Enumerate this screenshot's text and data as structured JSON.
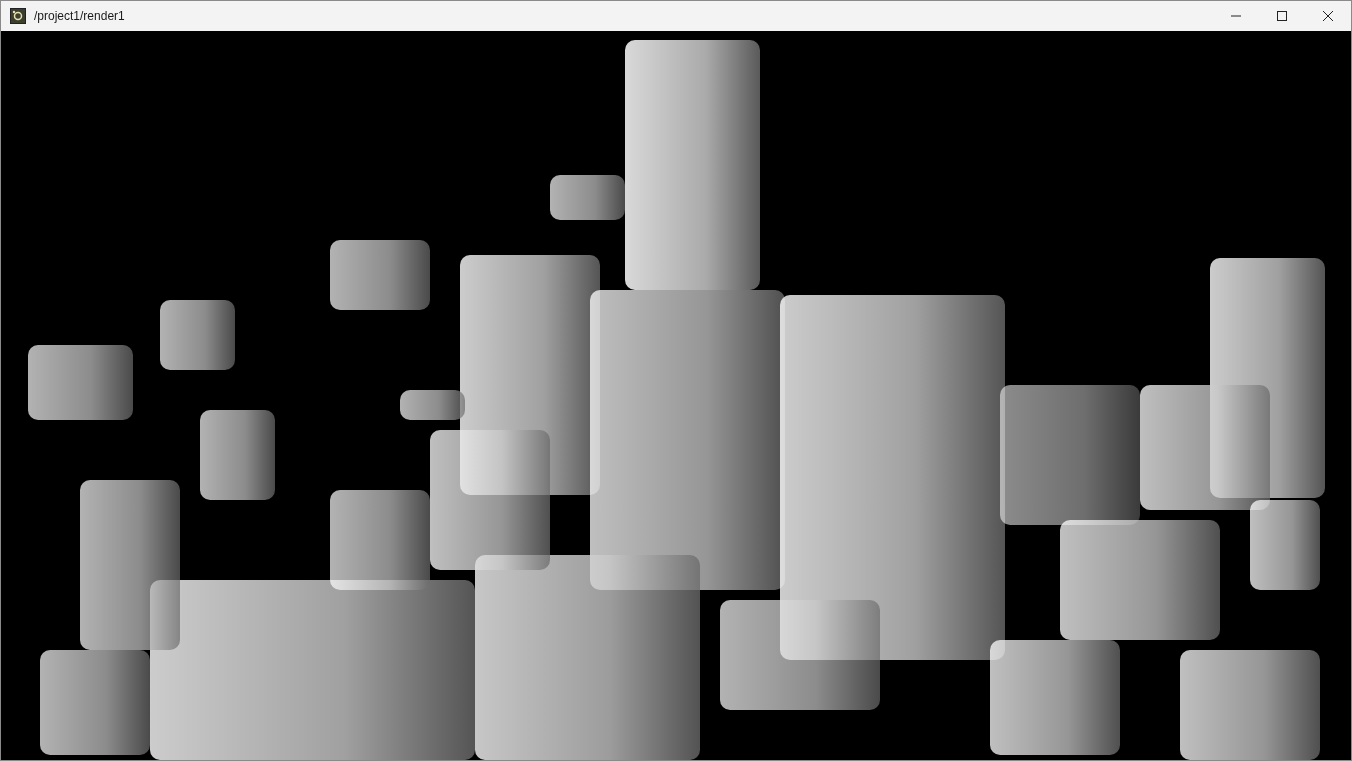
{
  "window": {
    "title": "/project1/render1"
  },
  "viewport": {
    "kind": "render"
  }
}
